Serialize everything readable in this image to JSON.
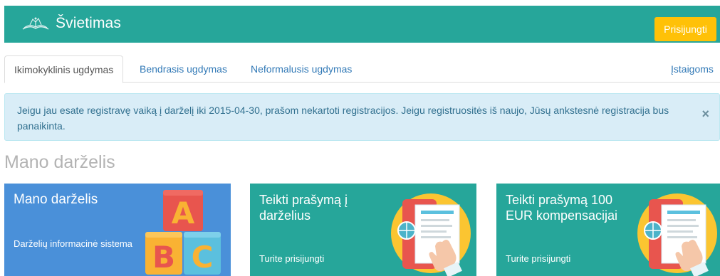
{
  "header": {
    "title": "Švietimas",
    "login_label": "Prisijungti",
    "logo_icon": "book-logo-icon",
    "colors": {
      "bar": "#26a69a",
      "login": "#ffc107"
    }
  },
  "tabs": [
    {
      "label": "Ikimokyklinis ugdymas",
      "active": true
    },
    {
      "label": "Bendrasis ugdymas",
      "active": false
    },
    {
      "label": "Neformalusis ugdymas",
      "active": false
    }
  ],
  "right_link": "Įstaigoms",
  "alert": {
    "text": "Jeigu jau esate registravę vaiką į darželį iki 2015-04-30, prašom nekartoti registracijos. Jeigu registruositės iš naujo, Jūsų ankstesnė registracija bus panaikinta.",
    "close": "×"
  },
  "section": {
    "title": "Mano darželis"
  },
  "cards": [
    {
      "title": "Mano darželis",
      "subtitle": "Darželių informacinė sistema",
      "icon": "abc-blocks-icon",
      "color": "#4a90d9"
    },
    {
      "title": "Teikti prašymą į darželius",
      "subtitle": "Turite prisijungti",
      "icon": "touch-form-icon",
      "color": "#26a69a"
    },
    {
      "title": "Teikti prašymą 100 EUR kompensacijai",
      "subtitle": "Turite prisijungti",
      "icon": "touch-form-icon",
      "color": "#26a69a"
    }
  ]
}
